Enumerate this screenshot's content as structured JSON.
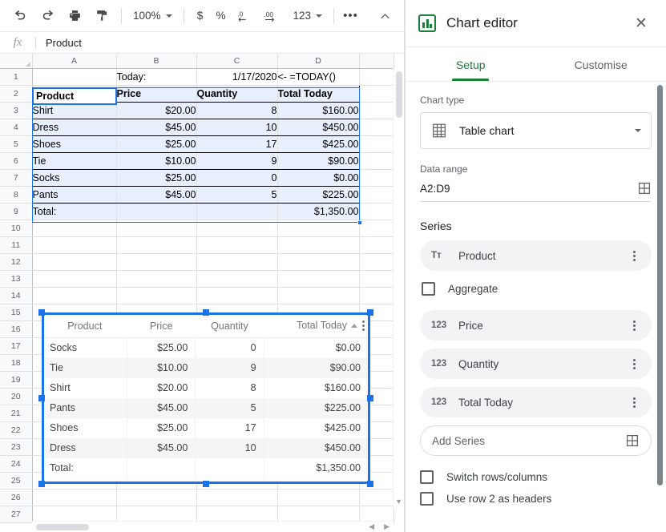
{
  "toolbar": {
    "undo_label": "undo",
    "redo_label": "redo",
    "print_label": "print",
    "paint_label": "paint-format",
    "zoom_value": "100%",
    "currency_label": "$",
    "percent_label": "%",
    "decrease_decimal_label": ".0",
    "increase_decimal_label": ".00",
    "number_format_label": "123",
    "more_label": "•••",
    "collapse_label": "⌃"
  },
  "formula_bar": {
    "fx_label": "fx",
    "value": "Product",
    "placeholder": ""
  },
  "sheet": {
    "columns": [
      "A",
      "B",
      "C",
      "D"
    ],
    "row_numbers": [
      "1",
      "2",
      "3",
      "4",
      "5",
      "6",
      "7",
      "8",
      "9",
      "10",
      "11",
      "12",
      "13",
      "14",
      "15",
      "16",
      "17",
      "18",
      "19",
      "20",
      "21",
      "22",
      "23",
      "24",
      "25",
      "26",
      "27"
    ],
    "cells": {
      "row1": {
        "A": "",
        "B": "Today:",
        "C": "1/17/2020",
        "D": "<- =TODAY()"
      },
      "header": {
        "A": "Product",
        "B": "Price",
        "C": "Quantity",
        "D": "Total Today"
      },
      "rows": [
        {
          "A": "Shirt",
          "B": "$20.00",
          "C": "8",
          "D": "$160.00"
        },
        {
          "A": "Dress",
          "B": "$45.00",
          "C": "10",
          "D": "$450.00"
        },
        {
          "A": "Shoes",
          "B": "$25.00",
          "C": "17",
          "D": "$425.00"
        },
        {
          "A": "Tie",
          "B": "$10.00",
          "C": "9",
          "D": "$90.00"
        },
        {
          "A": "Socks",
          "B": "$25.00",
          "C": "0",
          "D": "$0.00"
        },
        {
          "A": "Pants",
          "B": "$45.00",
          "C": "5",
          "D": "$225.00"
        }
      ],
      "total": {
        "A": "Total:",
        "B": "",
        "C": "",
        "D": "$1,350.00"
      }
    },
    "selection_range": "A2:D9",
    "active_cell": "A2",
    "active_cell_value": "Product",
    "selection_color": "#1a73e8",
    "selection_fill": "#e8f0fe"
  },
  "chart_data": {
    "type": "table",
    "title": "",
    "columns": [
      "Product",
      "Price",
      "Quantity",
      "Total Today"
    ],
    "sort_column": "Total Today",
    "sort_direction": "ascending",
    "rows": [
      {
        "Product": "Socks",
        "Price": "$25.00",
        "Quantity": "0",
        "Total Today": "$0.00"
      },
      {
        "Product": "Tie",
        "Price": "$10.00",
        "Quantity": "9",
        "Total Today": "$90.00"
      },
      {
        "Product": "Shirt",
        "Price": "$20.00",
        "Quantity": "8",
        "Total Today": "$160.00"
      },
      {
        "Product": "Pants",
        "Price": "$45.00",
        "Quantity": "5",
        "Total Today": "$225.00"
      },
      {
        "Product": "Shoes",
        "Price": "$25.00",
        "Quantity": "17",
        "Total Today": "$425.00"
      },
      {
        "Product": "Dress",
        "Price": "$45.00",
        "Quantity": "10",
        "Total Today": "$450.00"
      },
      {
        "Product": "Total:",
        "Price": "",
        "Quantity": "",
        "Total Today": "$1,350.00"
      }
    ],
    "values": {
      "Quantity": [
        0,
        9,
        8,
        5,
        17,
        10
      ],
      "Price": [
        25,
        10,
        20,
        45,
        25,
        45
      ],
      "Total Today": [
        0,
        90,
        160,
        225,
        425,
        450
      ]
    },
    "selected": true
  },
  "editor": {
    "title": "Chart editor",
    "close_label": "✕",
    "tabs": [
      {
        "label": "Setup",
        "active": true
      },
      {
        "label": "Customise",
        "active": false
      }
    ],
    "chart_type_label": "Chart type",
    "chart_type_value": "Table chart",
    "data_range_label": "Data range",
    "data_range_value": "A2:D9",
    "series_label": "Series",
    "series": [
      {
        "label": "Product",
        "type_icon": "Tт",
        "kind": "text"
      },
      {
        "label": "Price",
        "type_icon": "123",
        "kind": "number"
      },
      {
        "label": "Quantity",
        "type_icon": "123",
        "kind": "number"
      },
      {
        "label": "Total Today",
        "type_icon": "123",
        "kind": "number"
      }
    ],
    "aggregate_label": "Aggregate",
    "aggregate_checked": false,
    "add_series_label": "Add Series",
    "switch_rows_columns_label": "Switch rows/columns",
    "switch_rows_columns_checked": false,
    "use_row_headers_label": "Use row 2 as headers",
    "use_row_headers_checked": false,
    "accent_color": "#188038"
  }
}
